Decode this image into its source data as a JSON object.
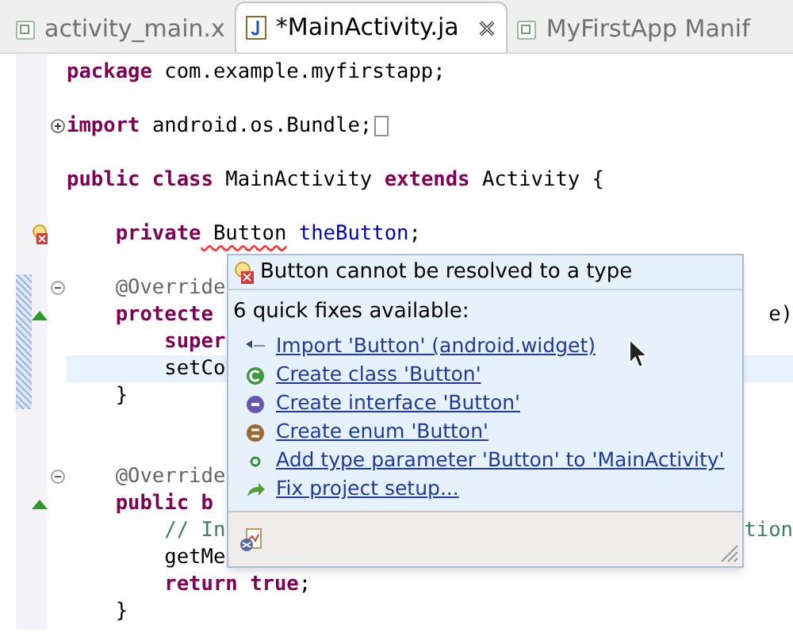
{
  "tabs": [
    {
      "label": "activity_main.x",
      "kind": "xml",
      "selected": false
    },
    {
      "label": "*MainActivity.ja",
      "kind": "java",
      "selected": true
    },
    {
      "label": "MyFirstApp Manif",
      "kind": "xml",
      "selected": false
    }
  ],
  "code_lines": [
    {
      "kind": "code",
      "current": false,
      "changed": false,
      "tokens": [
        {
          "kind": "keyword",
          "text": "package"
        },
        {
          "kind": "plain",
          "text": " com.example.myfirstapp;"
        }
      ]
    },
    {
      "kind": "blank"
    },
    {
      "kind": "code",
      "current": false,
      "changed": false,
      "fold": {
        "kind": "expand"
      },
      "folded_mark": true,
      "tokens": [
        {
          "kind": "keyword",
          "text": "import"
        },
        {
          "kind": "plain",
          "text": " android.os.Bundle;"
        }
      ]
    },
    {
      "kind": "blank"
    },
    {
      "kind": "code",
      "current": false,
      "changed": false,
      "tokens": [
        {
          "kind": "keyword",
          "text": "public class"
        },
        {
          "kind": "plain",
          "text": " MainActivity "
        },
        {
          "kind": "keyword",
          "text": "extends"
        },
        {
          "kind": "plain",
          "text": " Activity {"
        }
      ]
    },
    {
      "kind": "blank"
    },
    {
      "kind": "code",
      "current": false,
      "changed": false,
      "marker": {
        "kind": "error"
      },
      "tokens": [
        {
          "kind": "keyword",
          "text": "    private"
        },
        {
          "kind": "error",
          "text": " Button"
        },
        {
          "kind": "field",
          "text": " theButton"
        },
        {
          "kind": "plain",
          "text": ";"
        }
      ]
    },
    {
      "kind": "blank"
    },
    {
      "kind": "code",
      "current": false,
      "changed": true,
      "fold": {
        "kind": "collapse"
      },
      "tokens": [
        {
          "kind": "annotation",
          "text": "    @Override"
        }
      ]
    },
    {
      "kind": "code",
      "current": false,
      "changed": true,
      "marker": {
        "kind": "override"
      },
      "tokens": [
        {
          "kind": "keyword",
          "text": "    protecte"
        }
      ],
      "tail": {
        "kind": "plain",
        "text": "e)"
      }
    },
    {
      "kind": "code",
      "current": false,
      "changed": true,
      "tokens": [
        {
          "kind": "keyword",
          "text": "        super"
        }
      ]
    },
    {
      "kind": "code",
      "current": true,
      "changed": true,
      "tokens": [
        {
          "kind": "plain",
          "text": "        setCo"
        }
      ]
    },
    {
      "kind": "code",
      "current": false,
      "changed": true,
      "tokens": [
        {
          "kind": "plain",
          "text": "    }"
        }
      ]
    },
    {
      "kind": "blank"
    },
    {
      "kind": "blank"
    },
    {
      "kind": "code",
      "current": false,
      "changed": false,
      "fold": {
        "kind": "collapse"
      },
      "tokens": [
        {
          "kind": "annotation",
          "text": "    @Override"
        }
      ]
    },
    {
      "kind": "code",
      "current": false,
      "changed": false,
      "marker": {
        "kind": "override"
      },
      "tokens": [
        {
          "kind": "keyword",
          "text": "    public b"
        }
      ]
    },
    {
      "kind": "code",
      "current": false,
      "changed": false,
      "tokens": [
        {
          "kind": "comment",
          "text": "        // In"
        }
      ],
      "tail": {
        "kind": "comment",
        "text": "tion"
      }
    },
    {
      "kind": "code",
      "current": false,
      "changed": false,
      "tokens": [
        {
          "kind": "plain",
          "text": "        getMe"
        }
      ]
    },
    {
      "kind": "code",
      "current": false,
      "changed": false,
      "tokens": [
        {
          "kind": "keyword",
          "text": "        return true"
        },
        {
          "kind": "plain",
          "text": ";"
        }
      ]
    },
    {
      "kind": "code",
      "current": false,
      "changed": false,
      "tokens": [
        {
          "kind": "plain",
          "text": "    }"
        }
      ]
    }
  ],
  "quick_fix_popup": {
    "title": "Button cannot be resolved to a type",
    "summary": "6 quick fixes available:",
    "fixes": [
      {
        "kind": "import",
        "label": "Import 'Button' (android.widget)"
      },
      {
        "kind": "class",
        "label": "Create class 'Button'"
      },
      {
        "kind": "interface",
        "label": "Create interface 'Button'"
      },
      {
        "kind": "enum",
        "label": "Create enum 'Button'"
      },
      {
        "kind": "type-param",
        "label": "Add type parameter 'Button' to 'MainActivity'"
      },
      {
        "kind": "setup",
        "label": "Fix project setup..."
      }
    ]
  }
}
